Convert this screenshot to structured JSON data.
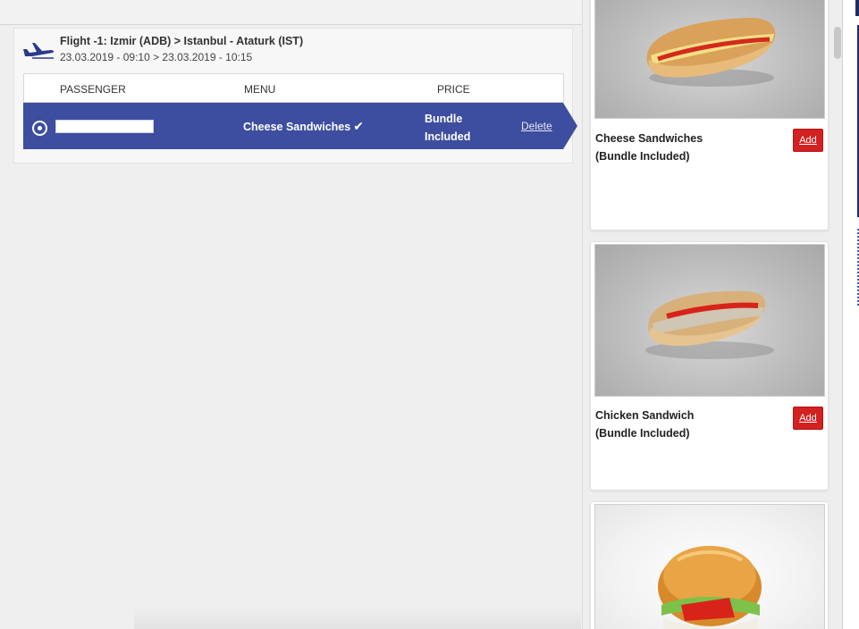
{
  "flight": {
    "title": "Flight -1: Izmir (ADB) > Istanbul - Ataturk (IST)",
    "dates": "23.03.2019 - 09:10 > 23.03.2019 - 10:15"
  },
  "table": {
    "headers": {
      "passenger": "PASSENGER",
      "menu": "MENU",
      "price": "PRICE"
    },
    "rows": [
      {
        "passenger_name": "",
        "menu": "Cheese Sandwiches",
        "check": "✔",
        "price_line1": "Bundle",
        "price_line2": "Included",
        "action": "Delete"
      }
    ]
  },
  "menu_items": [
    {
      "title_line1": "Cheese Sandwiches",
      "title_line2": "(Bundle Included)",
      "add_label": "Add"
    },
    {
      "title_line1": "Chicken Sandwich",
      "title_line2": "(Bundle Included)",
      "add_label": "Add"
    },
    {
      "title_line1": "",
      "title_line2": "",
      "add_label": ""
    }
  ],
  "colors": {
    "row_selected": "#3d4ea0",
    "add_button": "#d32020",
    "accent_navy": "#1d2a6b"
  },
  "icons": [
    "plane-icon",
    "radio-selected-icon",
    "check-icon"
  ]
}
